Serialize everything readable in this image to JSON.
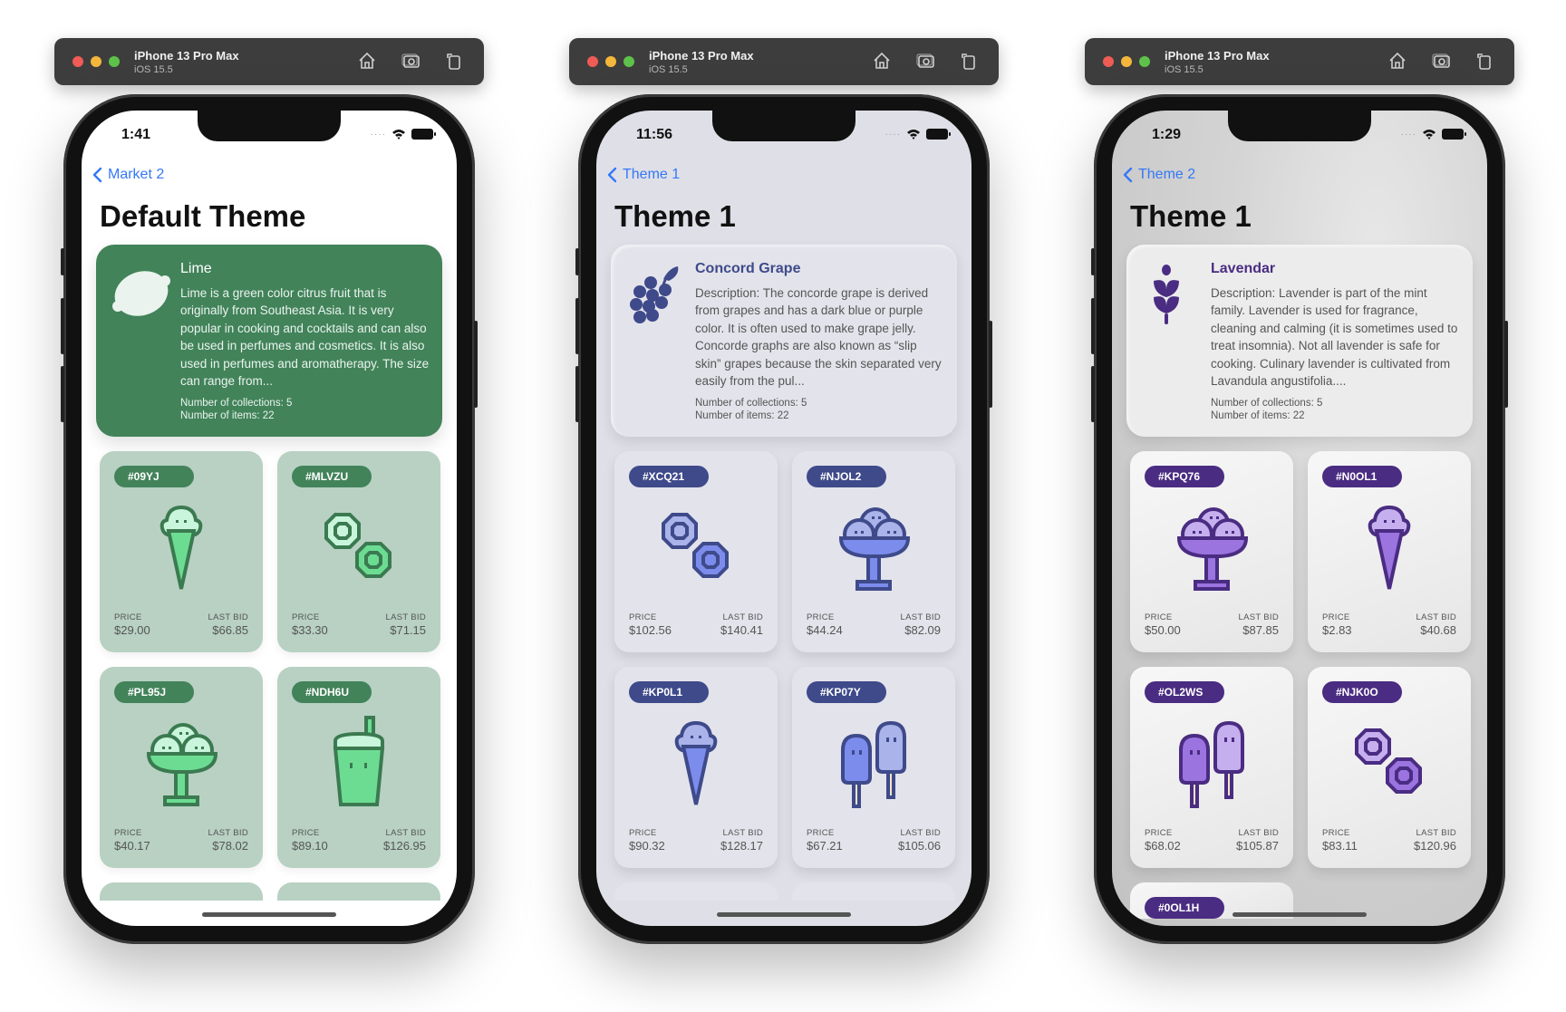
{
  "toolbar": {
    "device": "iPhone 13 Pro Max",
    "os": "iOS 15.5",
    "icons": [
      "home-icon",
      "screenshot-icon",
      "rotate-icon"
    ]
  },
  "labels": {
    "price": "PRICE",
    "last_bid": "LAST BID"
  },
  "phones": [
    {
      "time": "1:41",
      "back_label": "Market 2",
      "title": "Default Theme",
      "colors": {
        "screen_bg": "#ffffff",
        "hero_bg": "#42835a",
        "hero_text": "#eaf3ee",
        "card_bg": "#b8d1c3",
        "tag_bg": "#42835a",
        "icon_dark": "#3b7a50",
        "icon_mid": "#6ddc93",
        "icon_light": "#c9f5dc",
        "price_text": "#555555"
      },
      "hero": {
        "icon": "lime-icon",
        "name": "Lime",
        "description": "Lime is a green color citrus fruit that is originally from Southeast Asia.  It is very popular in cooking and cocktails and can also be used in perfumes and cosmetics.  It is also used in perfumes and aromatherapy.  The size can range from...",
        "collections": "Number of collections: 5",
        "items": "Number of items: 22"
      },
      "cards": [
        {
          "tag": "#09YJ",
          "art": "ice-cream-cone",
          "price": "$29.00",
          "last_bid": "$66.85"
        },
        {
          "tag": "#MLVZU",
          "art": "donuts",
          "price": "$33.30",
          "last_bid": "$71.15"
        },
        {
          "tag": "#PL95J",
          "art": "sundae",
          "price": "$40.17",
          "last_bid": "$78.02"
        },
        {
          "tag": "#NDH6U",
          "art": "drink-cup",
          "price": "$89.10",
          "last_bid": "$126.95"
        }
      ]
    },
    {
      "time": "11:56",
      "back_label": "Theme 1",
      "title": "Theme 1",
      "colors": {
        "screen_bg": "#dfdfe7",
        "hero_bg": "#e3e3eb",
        "hero_text": "#555555",
        "hero_name": "#3e4a8a",
        "card_bg": "#e3e3eb",
        "tag_bg": "#3e4a8a",
        "icon_dark": "#3e4a8a",
        "icon_mid": "#7b8cec",
        "icon_light": "#aab3ea",
        "price_text": "#555555"
      },
      "hero": {
        "icon": "grapes-icon",
        "name": "Concord Grape",
        "description": "Description: The concorde grape is derived from grapes and has a dark blue or purple color.  It is often used to make grape jelly.  Concorde graphs are also known as “slip skin” grapes because the skin separated very easily from the pul...",
        "collections": "Number of collections: 5",
        "items": "Number of items: 22"
      },
      "cards": [
        {
          "tag": "#XCQ21",
          "art": "donuts",
          "price": "$102.56",
          "last_bid": "$140.41"
        },
        {
          "tag": "#NJOL2",
          "art": "sundae",
          "price": "$44.24",
          "last_bid": "$82.09"
        },
        {
          "tag": "#KP0L1",
          "art": "ice-cream-cone",
          "price": "$90.32",
          "last_bid": "$128.17"
        },
        {
          "tag": "#KP07Y",
          "art": "popsicles",
          "price": "$67.21",
          "last_bid": "$105.06"
        }
      ]
    },
    {
      "time": "1:29",
      "back_label": "Theme 2",
      "title": "Theme 1",
      "colors": {
        "screen_bg": "#cfcfcf",
        "hero_bg": "#ececec",
        "hero_text": "#555555",
        "hero_name": "#4a2c82",
        "card_bg": "#eeeeee",
        "tag_bg": "#4a2c82",
        "icon_dark": "#4a2c82",
        "icon_mid": "#9b74e0",
        "icon_light": "#c6afee",
        "price_text": "#555555"
      },
      "hero": {
        "icon": "lavender-icon",
        "name": "Lavendar",
        "description": "Description: Lavender is part of the mint family.  Lavender is used for fragrance, cleaning and calming (it is sometimes used to treat insomnia).  Not all lavender is safe for cooking.  Culinary lavender is cultivated from Lavandula angustifolia....",
        "collections": "Number of collections: 5",
        "items": "Number of items: 22"
      },
      "cards": [
        {
          "tag": "#KPQ76",
          "art": "sundae",
          "price": "$50.00",
          "last_bid": "$87.85"
        },
        {
          "tag": "#N0OL1",
          "art": "ice-cream-cone",
          "price": "$2.83",
          "last_bid": "$40.68"
        },
        {
          "tag": "#OL2WS",
          "art": "popsicles",
          "price": "$68.02",
          "last_bid": "$105.87"
        },
        {
          "tag": "#NJK0O",
          "art": "donuts",
          "price": "$83.11",
          "last_bid": "$120.96"
        }
      ],
      "partial_card_tag": "#0OL1H"
    }
  ]
}
